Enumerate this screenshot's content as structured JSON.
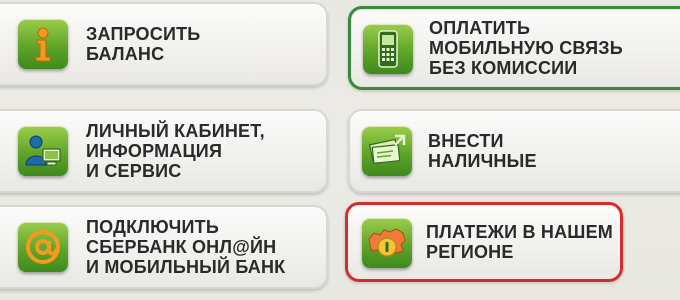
{
  "menu": {
    "buttons": [
      {
        "id": "request-balance",
        "icon": "info-icon",
        "lines": [
          "ЗАПРОСИТЬ",
          "БАЛАНС"
        ]
      },
      {
        "id": "pay-mobile",
        "icon": "mobile-phone-icon",
        "lines": [
          "ОПЛАТИТЬ",
          "МОБИЛЬНУЮ СВЯЗЬ",
          "БЕЗ КОМИССИИ"
        ]
      },
      {
        "id": "personal-cabinet",
        "icon": "user-computer-icon",
        "lines": [
          "ЛИЧНЫЙ КАБИНЕТ,",
          "ИНФОРМАЦИЯ",
          "И СЕРВИС"
        ]
      },
      {
        "id": "deposit-cash",
        "icon": "cash-deposit-icon",
        "lines": [
          "ВНЕСТИ",
          "НАЛИЧНЫЕ"
        ]
      },
      {
        "id": "connect-online",
        "icon": "at-sign-icon",
        "lines": [
          "ПОДКЛЮЧИТЬ",
          "СБЕРБАНК ОНЛ@ЙН",
          "И МОБИЛЬНЫЙ БАНК"
        ]
      },
      {
        "id": "regional-payments",
        "icon": "region-map-icon",
        "lines": [
          "ПЛАТЕЖИ В НАШЕМ",
          "РЕГИОНЕ"
        ]
      }
    ]
  },
  "colors": {
    "icon_green": "#5fa52a",
    "highlight_green": "#3b8a3b",
    "highlight_red": "#d42d2d",
    "text": "#2a2a2a"
  }
}
